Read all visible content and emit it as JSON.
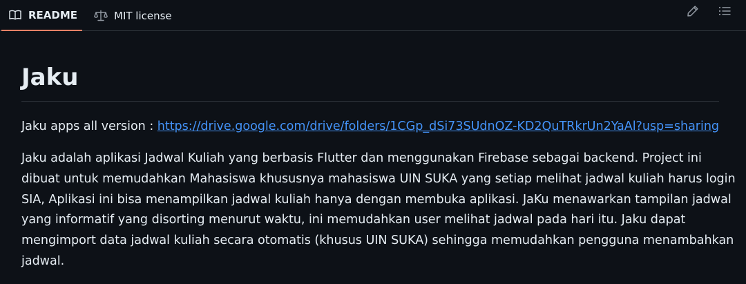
{
  "tabs": [
    {
      "label": "README",
      "icon": "book-icon",
      "active": true
    },
    {
      "label": "MIT license",
      "icon": "scale-icon",
      "active": false
    }
  ],
  "toolbar": {
    "edit_icon": "pencil-icon",
    "outline_icon": "list-unordered-icon"
  },
  "readme": {
    "title": "Jaku",
    "link_prefix": "Jaku apps all version : ",
    "link_text": "https://drive.google.com/drive/folders/1CGp_dSi73SUdnOZ-KD2QuTRkrUn2YaAl?usp=sharing",
    "description_lines": [
      "Jaku adalah aplikasi Jadwal Kuliah yang berbasis Flutter dan menggunakan Firebase sebagai backend. Project ini",
      "dibuat untuk memudahkan Mahasiswa khususnya mahasiswa UIN SUKA yang setiap melihat jadwal kuliah harus login",
      "SIA, Aplikasi ini bisa menampilkan jadwal kuliah hanya dengan membuka aplikasi. JaKu menawarkan tampilan jadwal",
      "yang informatif yang disorting menurut waktu, ini memudahkan user melihat jadwal pada hari itu. Jaku dapat",
      "mengimport data jadwal kuliah secara otomatis (khusus UIN SUKA) sehingga memudahkan pengguna menambahkan",
      "jadwal."
    ]
  },
  "colors": {
    "background": "#0d1117",
    "text": "#e6edf3",
    "link": "#4493f8",
    "active_tab_underline": "#f78166",
    "border": "#30363d",
    "icon": "#9198a1"
  }
}
